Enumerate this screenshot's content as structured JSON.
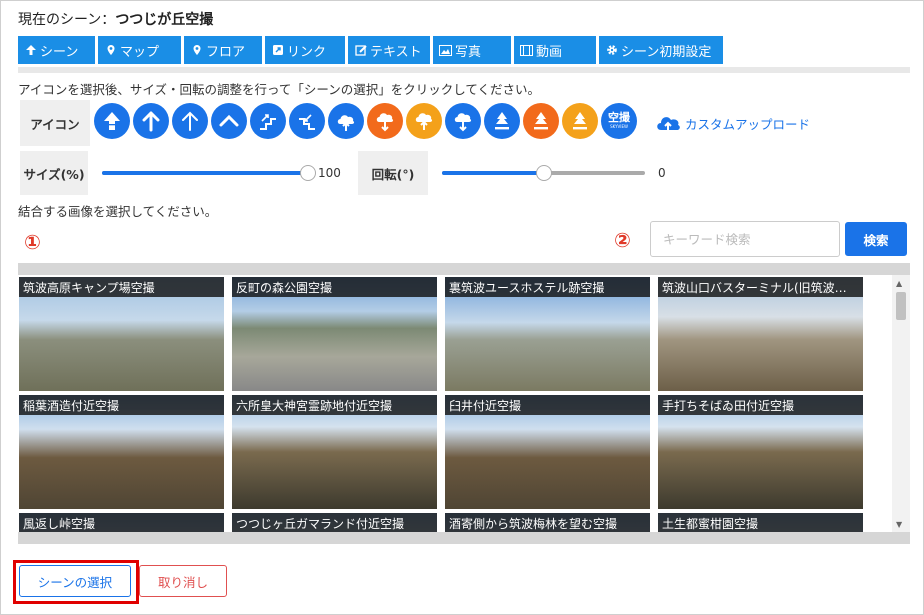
{
  "header": {
    "title_prefix": "現在のシーン：",
    "title_scene": "つつじが丘空撮"
  },
  "tabs": [
    {
      "label": "シーン",
      "icon": "arrow-up-icon"
    },
    {
      "label": "マップ",
      "icon": "map-pin-icon"
    },
    {
      "label": "フロア",
      "icon": "map-pin-icon"
    },
    {
      "label": "リンク",
      "icon": "external-link-icon"
    },
    {
      "label": "テキスト",
      "icon": "edit-icon"
    },
    {
      "label": "写真",
      "icon": "image-icon"
    },
    {
      "label": "動画",
      "icon": "film-icon"
    },
    {
      "label": "シーン初期設定",
      "icon": "gear-icon"
    }
  ],
  "instructions": {
    "icon_adjust": "アイコンを選択後、サイズ・回転の調整を行って「シーンの選択」をクリックしてください。",
    "select_image": "結合する画像を選択してください。"
  },
  "icon_row": {
    "label": "アイコン",
    "custom_upload": "カスタムアップロード",
    "sky_icon_text": "空撮",
    "sky_icon_sub": "SKYVIEW",
    "colors": {
      "blue": "#1a73e8",
      "orange": "#f26a1b",
      "amber": "#f4a11a"
    }
  },
  "size": {
    "label": "サイズ(%)",
    "value": "100",
    "fraction": 1.0
  },
  "rotation": {
    "label": "回転(°)",
    "value": "0",
    "fraction": 0.5
  },
  "markers": {
    "one": "①",
    "two": "②"
  },
  "search": {
    "placeholder": "キーワード検索",
    "button": "検索"
  },
  "images": [
    "筑波高原キャンプ場空撮",
    "反町の森公園空撮",
    "裏筑波ユースホステル跡空撮",
    "筑波山口バスターミナル(旧筑波…",
    "稲葉酒造付近空撮",
    "六所皇大神宮霊跡地付近空撮",
    "臼井付近空撮",
    "手打ちそばゐ田付近空撮",
    "風返し峠空撮",
    "つつじヶ丘ガマランド付近空撮",
    "酒寄側から筑波梅林を望む空撮",
    "土生都蜜柑園空撮"
  ],
  "buttons": {
    "select": "シーンの選択",
    "cancel": "取り消し"
  }
}
